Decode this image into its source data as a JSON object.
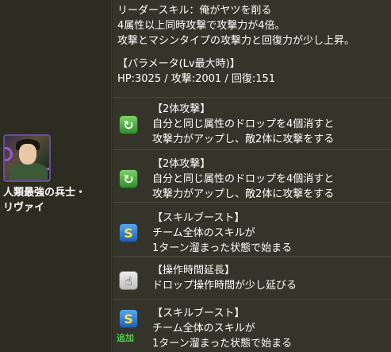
{
  "character": {
    "name_line1": "人類最強の兵士・",
    "name_line2": "リヴァイ"
  },
  "leader_skill": {
    "line1": "リーダースキル：俺がヤツを削る",
    "line2": "4属性以上同時攻撃で攻撃力が4倍。",
    "line3": "攻撃とマシンタイプの攻撃力と回復力が少し上昇。"
  },
  "params": {
    "heading": "【パラメータ(Lv最大時)】",
    "stats": "HP:3025 / 攻撃:2001 / 回復:151"
  },
  "awakenings": [
    {
      "icon": "two-body-attack-icon",
      "title": "【2体攻撃】",
      "desc1": "自分と同じ属性のドロップを4個消すと",
      "desc2": "攻撃力がアップし、敵2体に攻撃をする"
    },
    {
      "icon": "two-body-attack-icon",
      "title": "【2体攻撃】",
      "desc1": "自分と同じ属性のドロップを4個消すと",
      "desc2": "攻撃力がアップし、敵2体に攻撃をする"
    },
    {
      "icon": "skill-boost-icon",
      "title": "【スキルブースト】",
      "desc1": "チーム全体のスキルが",
      "desc2": "1ターン溜まった状態で始まる"
    },
    {
      "icon": "time-extend-icon",
      "title": "【操作時間延長】",
      "desc1": "ドロップ操作時間が少し延びる"
    },
    {
      "icon": "skill-boost-icon",
      "title": "【スキルブースト】",
      "desc1": "チーム全体のスキルが",
      "desc2": "1ターン溜まった状態で始まる",
      "badge": "追加"
    }
  ]
}
